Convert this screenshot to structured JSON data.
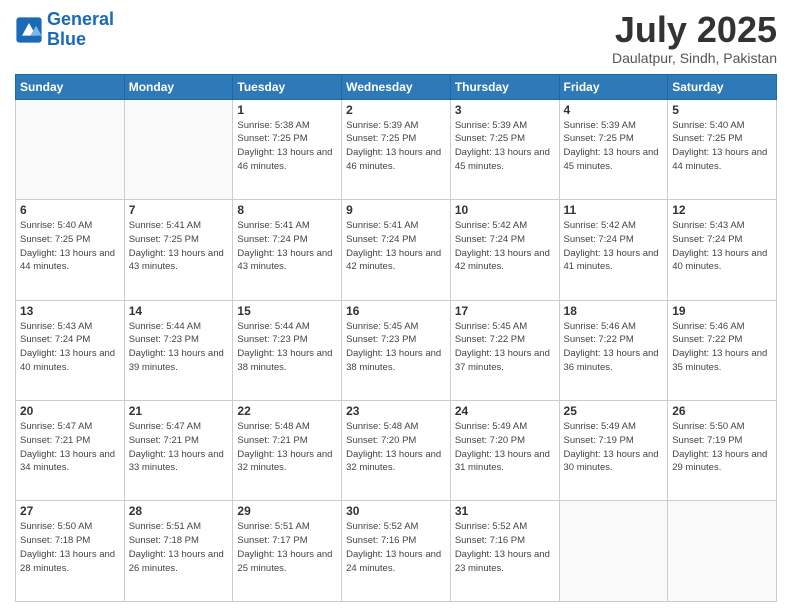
{
  "logo": {
    "line1": "General",
    "line2": "Blue"
  },
  "title": "July 2025",
  "subtitle": "Daulatpur, Sindh, Pakistan",
  "days_of_week": [
    "Sunday",
    "Monday",
    "Tuesday",
    "Wednesday",
    "Thursday",
    "Friday",
    "Saturday"
  ],
  "weeks": [
    [
      {
        "day": "",
        "info": ""
      },
      {
        "day": "",
        "info": ""
      },
      {
        "day": "1",
        "info": "Sunrise: 5:38 AM\nSunset: 7:25 PM\nDaylight: 13 hours and 46 minutes."
      },
      {
        "day": "2",
        "info": "Sunrise: 5:39 AM\nSunset: 7:25 PM\nDaylight: 13 hours and 46 minutes."
      },
      {
        "day": "3",
        "info": "Sunrise: 5:39 AM\nSunset: 7:25 PM\nDaylight: 13 hours and 45 minutes."
      },
      {
        "day": "4",
        "info": "Sunrise: 5:39 AM\nSunset: 7:25 PM\nDaylight: 13 hours and 45 minutes."
      },
      {
        "day": "5",
        "info": "Sunrise: 5:40 AM\nSunset: 7:25 PM\nDaylight: 13 hours and 44 minutes."
      }
    ],
    [
      {
        "day": "6",
        "info": "Sunrise: 5:40 AM\nSunset: 7:25 PM\nDaylight: 13 hours and 44 minutes."
      },
      {
        "day": "7",
        "info": "Sunrise: 5:41 AM\nSunset: 7:25 PM\nDaylight: 13 hours and 43 minutes."
      },
      {
        "day": "8",
        "info": "Sunrise: 5:41 AM\nSunset: 7:24 PM\nDaylight: 13 hours and 43 minutes."
      },
      {
        "day": "9",
        "info": "Sunrise: 5:41 AM\nSunset: 7:24 PM\nDaylight: 13 hours and 42 minutes."
      },
      {
        "day": "10",
        "info": "Sunrise: 5:42 AM\nSunset: 7:24 PM\nDaylight: 13 hours and 42 minutes."
      },
      {
        "day": "11",
        "info": "Sunrise: 5:42 AM\nSunset: 7:24 PM\nDaylight: 13 hours and 41 minutes."
      },
      {
        "day": "12",
        "info": "Sunrise: 5:43 AM\nSunset: 7:24 PM\nDaylight: 13 hours and 40 minutes."
      }
    ],
    [
      {
        "day": "13",
        "info": "Sunrise: 5:43 AM\nSunset: 7:24 PM\nDaylight: 13 hours and 40 minutes."
      },
      {
        "day": "14",
        "info": "Sunrise: 5:44 AM\nSunset: 7:23 PM\nDaylight: 13 hours and 39 minutes."
      },
      {
        "day": "15",
        "info": "Sunrise: 5:44 AM\nSunset: 7:23 PM\nDaylight: 13 hours and 38 minutes."
      },
      {
        "day": "16",
        "info": "Sunrise: 5:45 AM\nSunset: 7:23 PM\nDaylight: 13 hours and 38 minutes."
      },
      {
        "day": "17",
        "info": "Sunrise: 5:45 AM\nSunset: 7:22 PM\nDaylight: 13 hours and 37 minutes."
      },
      {
        "day": "18",
        "info": "Sunrise: 5:46 AM\nSunset: 7:22 PM\nDaylight: 13 hours and 36 minutes."
      },
      {
        "day": "19",
        "info": "Sunrise: 5:46 AM\nSunset: 7:22 PM\nDaylight: 13 hours and 35 minutes."
      }
    ],
    [
      {
        "day": "20",
        "info": "Sunrise: 5:47 AM\nSunset: 7:21 PM\nDaylight: 13 hours and 34 minutes."
      },
      {
        "day": "21",
        "info": "Sunrise: 5:47 AM\nSunset: 7:21 PM\nDaylight: 13 hours and 33 minutes."
      },
      {
        "day": "22",
        "info": "Sunrise: 5:48 AM\nSunset: 7:21 PM\nDaylight: 13 hours and 32 minutes."
      },
      {
        "day": "23",
        "info": "Sunrise: 5:48 AM\nSunset: 7:20 PM\nDaylight: 13 hours and 32 minutes."
      },
      {
        "day": "24",
        "info": "Sunrise: 5:49 AM\nSunset: 7:20 PM\nDaylight: 13 hours and 31 minutes."
      },
      {
        "day": "25",
        "info": "Sunrise: 5:49 AM\nSunset: 7:19 PM\nDaylight: 13 hours and 30 minutes."
      },
      {
        "day": "26",
        "info": "Sunrise: 5:50 AM\nSunset: 7:19 PM\nDaylight: 13 hours and 29 minutes."
      }
    ],
    [
      {
        "day": "27",
        "info": "Sunrise: 5:50 AM\nSunset: 7:18 PM\nDaylight: 13 hours and 28 minutes."
      },
      {
        "day": "28",
        "info": "Sunrise: 5:51 AM\nSunset: 7:18 PM\nDaylight: 13 hours and 26 minutes."
      },
      {
        "day": "29",
        "info": "Sunrise: 5:51 AM\nSunset: 7:17 PM\nDaylight: 13 hours and 25 minutes."
      },
      {
        "day": "30",
        "info": "Sunrise: 5:52 AM\nSunset: 7:16 PM\nDaylight: 13 hours and 24 minutes."
      },
      {
        "day": "31",
        "info": "Sunrise: 5:52 AM\nSunset: 7:16 PM\nDaylight: 13 hours and 23 minutes."
      },
      {
        "day": "",
        "info": ""
      },
      {
        "day": "",
        "info": ""
      }
    ]
  ]
}
